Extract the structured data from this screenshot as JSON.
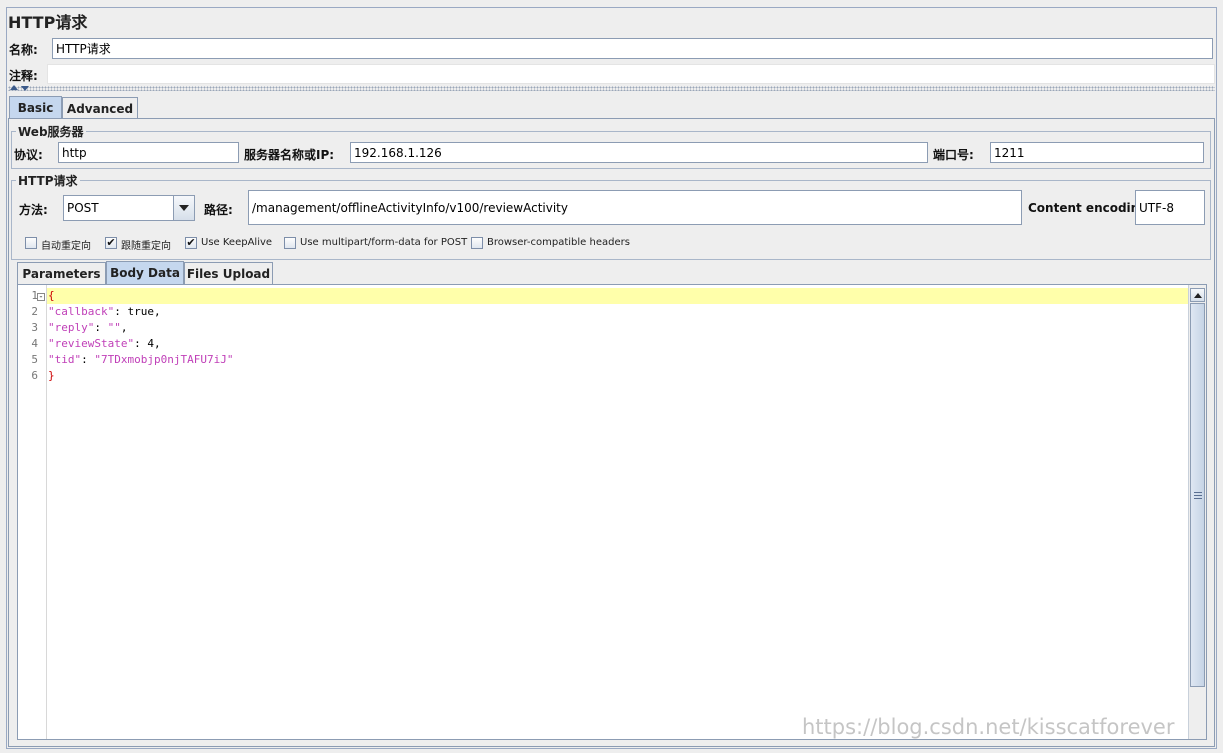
{
  "window": {
    "title": "HTTP请求"
  },
  "name_row": {
    "label": "名称:",
    "value": "HTTP请求"
  },
  "comment_row": {
    "label": "注释:",
    "value": ""
  },
  "tabs": [
    {
      "label": "Basic",
      "active": true
    },
    {
      "label": "Advanced",
      "active": false
    }
  ],
  "web_server": {
    "title": "Web服务器",
    "protocol_label": "协议:",
    "protocol_value": "http",
    "server_label": "服务器名称或IP:",
    "server_value": "192.168.1.126",
    "port_label": "端口号:",
    "port_value": "1211"
  },
  "http_request": {
    "title": "HTTP请求",
    "method_label": "方法:",
    "method_value": "POST",
    "path_label": "路径:",
    "path_value": "/management/offlineActivityInfo/v100/reviewActivity",
    "encoding_label": "Content encoding:",
    "encoding_value": "UTF-8"
  },
  "checkboxes": [
    {
      "label": "自动重定向",
      "checked": false
    },
    {
      "label": "跟随重定向",
      "checked": true
    },
    {
      "label": "Use KeepAlive",
      "checked": true
    },
    {
      "label": "Use multipart/form-data for POST",
      "checked": false
    },
    {
      "label": "Browser-compatible headers",
      "checked": false
    }
  ],
  "sub_tabs": [
    {
      "label": "Parameters",
      "active": false
    },
    {
      "label": "Body Data",
      "active": true
    },
    {
      "label": "Files Upload",
      "active": false
    }
  ],
  "editor": {
    "line_numbers": [
      "1",
      "2",
      "3",
      "4",
      "5",
      "6"
    ],
    "lines": {
      "l1_brace": "{",
      "l2_key": "\"callback\"",
      "l2_sep": ": ",
      "l2_val": "true,",
      "l3_key": "\"reply\"",
      "l3_sep": ": ",
      "l3_val": "\"\"",
      "l3_end": ",",
      "l4_key": "\"reviewState\"",
      "l4_sep": ": ",
      "l4_val": "4,",
      "l5_key": "\"tid\"",
      "l5_sep": ": ",
      "l5_val": "\"7TDxmobjp0njTAFU7iJ\"",
      "l6_brace": "}"
    },
    "fold_marker": "-"
  },
  "watermark": "https://blog.csdn.net/kisscatforever",
  "colors": {
    "tab_active": "#c5d7ee",
    "highlight_line": "#ffffaa",
    "json_key": "#c03fb8",
    "json_brace": "#cc0000"
  }
}
